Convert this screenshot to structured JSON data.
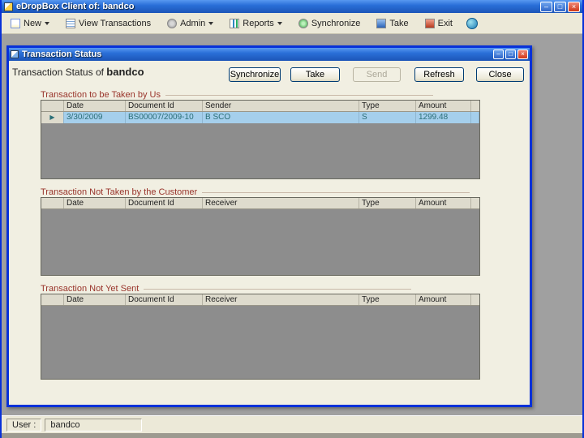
{
  "window": {
    "title": "eDropBox Client of: bandco",
    "controls": {
      "minimize": "–",
      "maximize": "□",
      "close": "×"
    }
  },
  "toolbar": {
    "items": [
      {
        "label": "New",
        "dropdown": true
      },
      {
        "label": "View Transactions",
        "dropdown": false
      },
      {
        "label": "Admin",
        "dropdown": true
      },
      {
        "label": "Reports",
        "dropdown": true
      },
      {
        "label": "Synchronize",
        "dropdown": false
      },
      {
        "label": "Take",
        "dropdown": false
      },
      {
        "label": "Exit",
        "dropdown": false
      }
    ],
    "icon_names": [
      "new-icon",
      "view-transactions-icon",
      "admin-icon",
      "reports-icon",
      "synchronize-icon",
      "take-icon",
      "exit-icon",
      "globe-icon"
    ]
  },
  "dialog": {
    "title": "Transaction Status",
    "heading_prefix": "Transaction Status of ",
    "heading_name": "bandco",
    "buttons": [
      {
        "label": "Synchronize",
        "enabled": true
      },
      {
        "label": "Take",
        "enabled": true
      },
      {
        "label": "Send",
        "enabled": false
      },
      {
        "label": "Refresh",
        "enabled": true
      },
      {
        "label": "Close",
        "enabled": true
      }
    ],
    "sections": [
      {
        "title": "Transaction to be Taken by Us",
        "columns": [
          "Date",
          "Document Id",
          "Sender",
          "Type",
          "Amount"
        ],
        "rows": [
          [
            "3/30/2009",
            "BS00007/2009-10",
            "B SCO",
            "S",
            "1299.48"
          ]
        ]
      },
      {
        "title": "Transaction Not Taken by the Customer",
        "columns": [
          "Date",
          "Document Id",
          "Receiver",
          "Type",
          "Amount"
        ],
        "rows": []
      },
      {
        "title": "Transaction Not Yet Sent",
        "columns": [
          "Date",
          "Document Id",
          "Receiver",
          "Type",
          "Amount"
        ],
        "rows": []
      }
    ]
  },
  "icons": {
    "row_marker": "▶"
  },
  "statusbar": {
    "user_label": "User :",
    "user_value": "bandco"
  }
}
